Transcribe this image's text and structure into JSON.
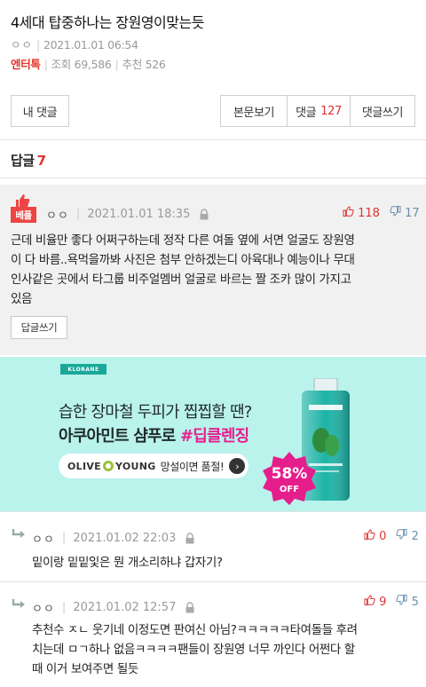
{
  "post": {
    "title": "4세대 탑중하나는 장원영이맞는듯",
    "author": "ㅇㅇ",
    "date": "2021.01.01 06:54",
    "category": "엔터톡",
    "views_label": "조회",
    "views": "69,586",
    "recommend_label": "추천",
    "recommend": "526"
  },
  "toolbar": {
    "my_comments": "내 댓글",
    "view_body": "본문보기",
    "comments_label": "댓글",
    "comments_count": "127",
    "write_comment": "댓글쓰기"
  },
  "replies": {
    "label": "답글",
    "count": "7"
  },
  "best_comment": {
    "badge": "베플",
    "nick": "ㅇㅇ",
    "date": "2021.01.01 18:35",
    "up": "118",
    "down": "17",
    "lines": [
      "근데 비율만 좋다 어쩌구하는데 정작 다른 여돌 옆에 서면 얼굴도 장원영",
      "이 다 바름..욕먹을까봐 사진은 첨부 안하겠는디 아육대나 예능이나 무대",
      "인사같은 곳에서 타그룹 비주얼멤버 얼굴로 바르는 짤 조카 많이 가지고",
      "있음"
    ],
    "reply_button": "답글쓰기"
  },
  "ad": {
    "brand": "KLORANE",
    "line1": "습한 장마철 두피가 찝찝할 땐?",
    "line2_a": "아쿠아민트 샴푸로 ",
    "line2_b": "#딥클렌징",
    "store_a": "OLIVE",
    "store_b": "YOUNG",
    "pill_text": "망설이면 품절!",
    "discount": "58%",
    "discount_sub": "OFF",
    "accent": "#e61e8c",
    "bg": "#baf3ec"
  },
  "sub_comments": [
    {
      "nick": "ㅇㅇ",
      "date": "2021.01.02 22:03",
      "up": "0",
      "down": "2",
      "lines": [
        "밑이랑 밑밑잋은 뭔 개소리하냐 갑자기?"
      ]
    },
    {
      "nick": "ㅇㅇ",
      "date": "2021.01.02 12:57",
      "up": "9",
      "down": "5",
      "lines": [
        "추천수 ㅈㄴ 웃기네 이정도면 판여신 아님?ㅋㅋㅋㅋㅋ타여돌들 후려",
        "치는데 ㅁㄱ하나 없음ㅋㅋㅋㅋ팬들이 장원영 너무 까인다 어쩐다 할",
        "때 이거 보여주면 될듯"
      ]
    }
  ]
}
